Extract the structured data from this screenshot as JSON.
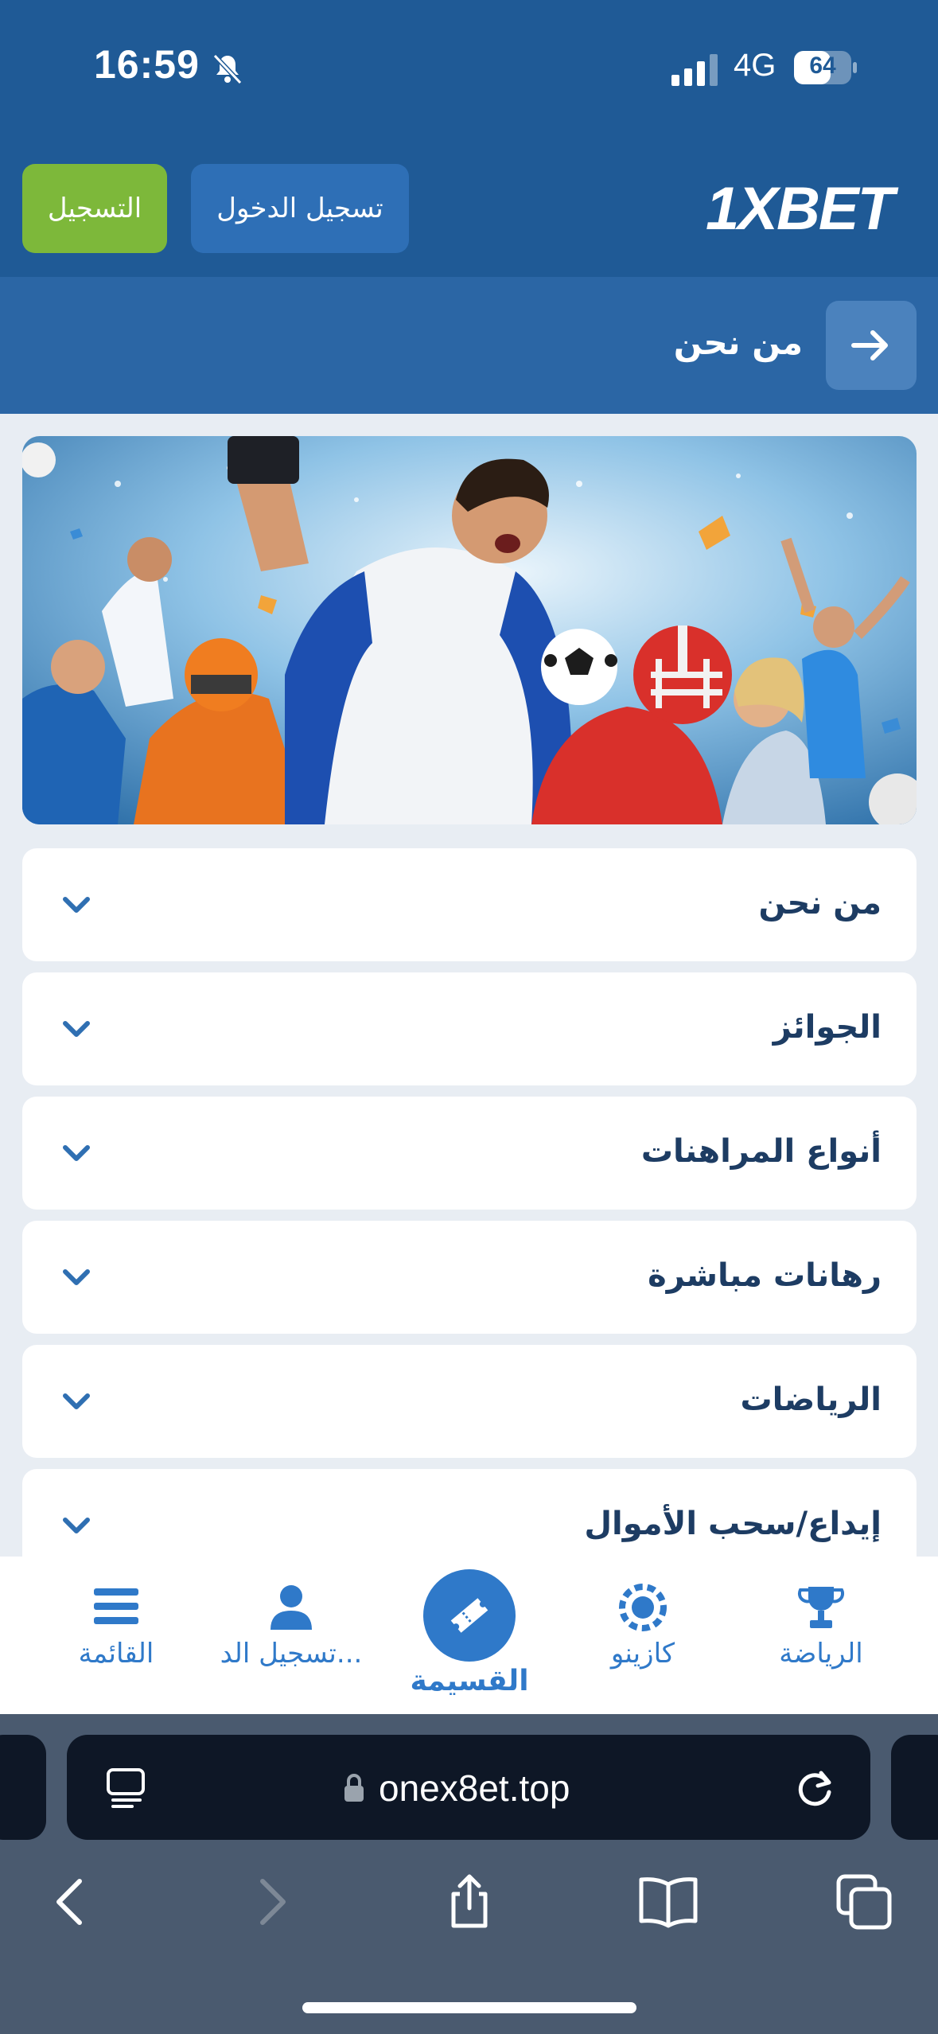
{
  "status_bar": {
    "time": "16:59",
    "network": "4G",
    "battery": "64",
    "battery_level": 0.64
  },
  "header": {
    "register_label": "التسجيل",
    "login_label": "تسجيل الدخول",
    "logo_text": "1XBET"
  },
  "subheader": {
    "title": "من نحن"
  },
  "accordion": [
    {
      "label": "من نحن"
    },
    {
      "label": "الجوائز"
    },
    {
      "label": "أنواع المراهنات"
    },
    {
      "label": "رهانات مباشرة"
    },
    {
      "label": "الرياضات"
    },
    {
      "label": "إيداع/سحب الأموال"
    }
  ],
  "bottom_nav": {
    "menu": "القائمة",
    "login": "تسجيل الد...",
    "coupon": "القسيمة",
    "casino": "كازينو",
    "sports": "الرياضة"
  },
  "browser": {
    "url": "onex8et.top"
  },
  "colors": {
    "header_bg": "#1f5a96",
    "accent_blue": "#2f79c9",
    "register_green": "#7db83a"
  }
}
